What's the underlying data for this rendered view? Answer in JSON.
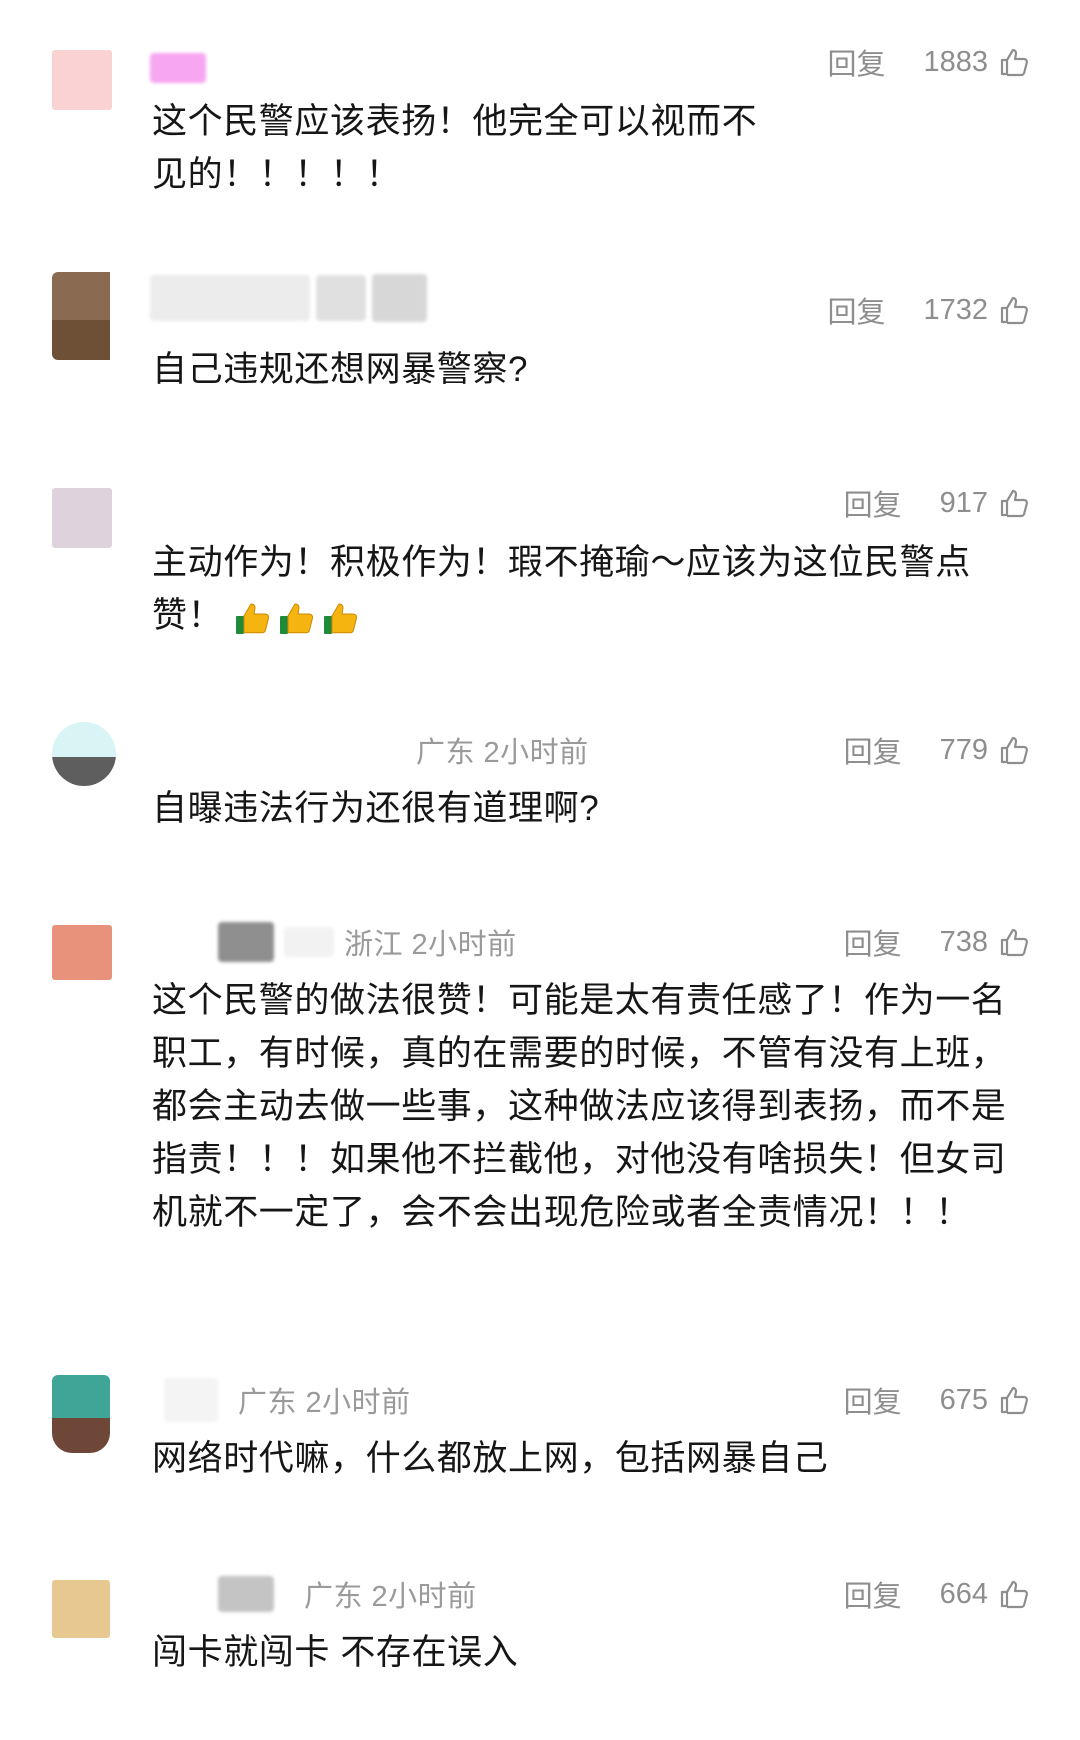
{
  "reply_label": "回复",
  "comments": [
    {
      "avatar_colors": [
        "#fbd2d4",
        "#fbd2d4"
      ],
      "name_colors": [
        "#f7a7f1"
      ],
      "meta": "",
      "likes": "1883",
      "text": "这个民警应该表扬！他完全可以视而不见的！！！！！"
    },
    {
      "avatar_colors": [
        "#8b6a52",
        "#6d5035"
      ],
      "name_colors": [
        "#ececec",
        "#e0e0e0",
        "#d7d7d7"
      ],
      "meta": "",
      "likes": "1732",
      "text": "自己违规还想网暴警察?"
    },
    {
      "avatar_colors": [
        "#ded2dc",
        "#ded2dc"
      ],
      "name_colors": [],
      "meta": "",
      "likes": "917",
      "text": "主动作为！积极作为！瑕不掩瑜～应该为这位民警点赞！"
    },
    {
      "avatar_colors": [
        "#d9f4f5",
        "#5e5e5e"
      ],
      "name_colors": [],
      "meta": "广东 2小时前",
      "likes": "779",
      "text": "自曝违法行为还很有道理啊?"
    },
    {
      "avatar_colors": [
        "#e8917b",
        "#e8917b"
      ],
      "name_colors": [
        "#8f8f8f",
        "#f2f2f2"
      ],
      "meta": "浙江 2小时前",
      "likes": "738",
      "text": "这个民警的做法很赞！可能是太有责任感了！作为一名职工，有时候，真的在需要的时候，不管有没有上班，都会主动去做一些事，这种做法应该得到表扬，而不是指责！！！如果他不拦截他，对他没有啥损失！但女司机就不一定了，会不会出现危险或者全责情况！！！"
    },
    {
      "avatar_colors": [
        "#3ea597",
        "#6e4738"
      ],
      "name_colors": [
        "#f4f4f4"
      ],
      "meta": "广东 2小时前",
      "likes": "675",
      "text": "网络时代嘛，什么都放上网，包括网暴自己"
    },
    {
      "avatar_colors": [
        "#e8c891",
        "#e8c891"
      ],
      "name_colors": [
        "#c4c4c4"
      ],
      "meta": "广东 2小时前",
      "likes": "664",
      "text": "闯卡就闯卡 不存在误入"
    }
  ]
}
